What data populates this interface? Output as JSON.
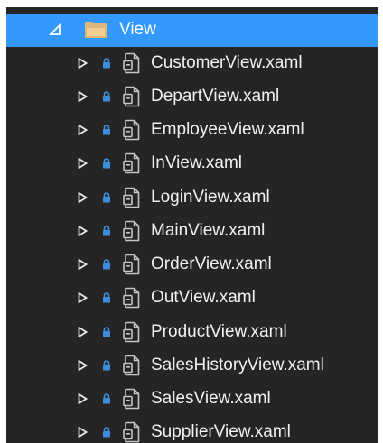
{
  "colors": {
    "panel_background": "#252526",
    "selection": "#3399ff",
    "text": "#f1f1f1",
    "folder": "#dcb67a",
    "lock": "#3c8ddb",
    "file_icon": "#c5c5c5"
  },
  "tree": {
    "folder": {
      "label": "View",
      "expanded": true,
      "selected": true,
      "icon": "folder-icon"
    },
    "files": [
      {
        "label": "CustomerView.xaml",
        "icon": "xaml-file-icon",
        "locked": true
      },
      {
        "label": "DepartView.xaml",
        "icon": "xaml-file-icon",
        "locked": true
      },
      {
        "label": "EmployeeView.xaml",
        "icon": "xaml-file-icon",
        "locked": true
      },
      {
        "label": "InView.xaml",
        "icon": "xaml-file-icon",
        "locked": true
      },
      {
        "label": "LoginView.xaml",
        "icon": "xaml-file-icon",
        "locked": true
      },
      {
        "label": "MainView.xaml",
        "icon": "xaml-file-icon",
        "locked": true
      },
      {
        "label": "OrderView.xaml",
        "icon": "xaml-file-icon",
        "locked": true
      },
      {
        "label": "OutView.xaml",
        "icon": "xaml-file-icon",
        "locked": true
      },
      {
        "label": "ProductView.xaml",
        "icon": "xaml-file-icon",
        "locked": true
      },
      {
        "label": "SalesHistoryView.xaml",
        "icon": "xaml-file-icon",
        "locked": true
      },
      {
        "label": "SalesView.xaml",
        "icon": "xaml-file-icon",
        "locked": true
      },
      {
        "label": "SupplierView.xaml",
        "icon": "xaml-file-icon",
        "locked": true
      }
    ]
  }
}
